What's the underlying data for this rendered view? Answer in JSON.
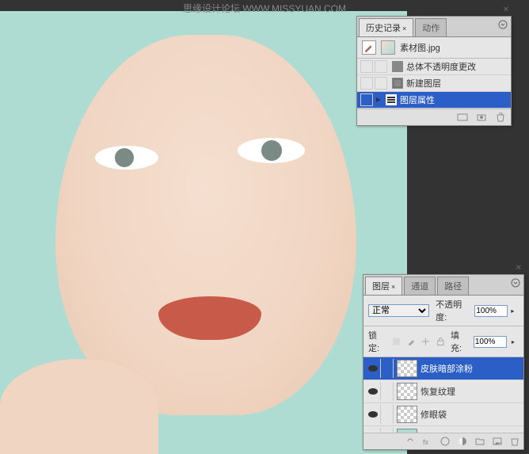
{
  "watermark": "思缘设计论坛 WWW.MISSYUAN.COM",
  "history_panel": {
    "tabs": [
      {
        "label": "历史记录",
        "active": true
      },
      {
        "label": "动作",
        "active": false
      }
    ],
    "document_name": "素材图.jpg",
    "items": [
      {
        "label": "总体不透明度更改",
        "selected": false
      },
      {
        "label": "新建图层",
        "selected": false
      },
      {
        "label": "图层属性",
        "selected": true
      }
    ]
  },
  "layers_panel": {
    "tabs": [
      {
        "label": "图层",
        "active": true
      },
      {
        "label": "通道",
        "active": false
      },
      {
        "label": "路径",
        "active": false
      }
    ],
    "blend_mode": "正常",
    "opacity_label": "不透明度:",
    "opacity_value": "100%",
    "lock_label": "锁定:",
    "fill_label": "填充:",
    "fill_value": "100%",
    "layers": [
      {
        "name": "皮肤暗部涂粉",
        "selected": true,
        "visible": true,
        "transparent": true
      },
      {
        "name": "恢复纹理",
        "selected": false,
        "visible": true,
        "transparent": true
      },
      {
        "name": "修眼袋",
        "selected": false,
        "visible": true,
        "transparent": true
      },
      {
        "name": "",
        "selected": false,
        "visible": true,
        "transparent": false
      }
    ]
  }
}
